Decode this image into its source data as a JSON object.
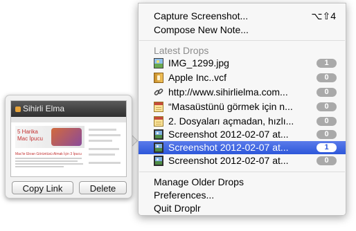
{
  "menu": {
    "capture": {
      "label": "Capture Screenshot...",
      "shortcut": "⌥⇧4"
    },
    "compose": {
      "label": "Compose New Note..."
    },
    "latest_drops_header": "Latest Drops",
    "drops": [
      {
        "name": "IMG_1299.jpg",
        "count": "1",
        "icon": "image-file-icon",
        "selected": false
      },
      {
        "name": "Apple Inc..vcf",
        "count": "0",
        "icon": "vcard-file-icon",
        "selected": false
      },
      {
        "name": "http://www.sihirlielma.com...",
        "count": "0",
        "icon": "link-icon",
        "selected": false
      },
      {
        "name": "“Masaüstünü görmek için n...",
        "count": "0",
        "icon": "note-icon",
        "selected": false
      },
      {
        "name": "2. Dosyaları açmadan, hızlı...",
        "count": "0",
        "icon": "note-icon",
        "selected": false
      },
      {
        "name": "Screenshot 2012-02-07 at...",
        "count": "0",
        "icon": "screenshot-icon",
        "selected": false
      },
      {
        "name": "Screenshot 2012-02-07 at...",
        "count": "1",
        "icon": "screenshot-icon",
        "selected": true
      },
      {
        "name": "Screenshot 2012-02-07 at...",
        "count": "0",
        "icon": "screenshot-icon",
        "selected": false
      }
    ],
    "manage_older": "Manage Older Drops",
    "preferences": "Preferences...",
    "quit": "Quit Droplr"
  },
  "preview": {
    "site_title": "Sihirli Elma",
    "ad_title": "5 Harika Mac İpucu",
    "post_title": "Mac'te Ekran Görüntüsü Almak İçin 3 İpucu",
    "copy_link_label": "Copy Link",
    "delete_label": "Delete"
  },
  "colors": {
    "selection": "#2d57da",
    "badge": "#a9a9a9",
    "header_text": "#8c8c8c"
  }
}
